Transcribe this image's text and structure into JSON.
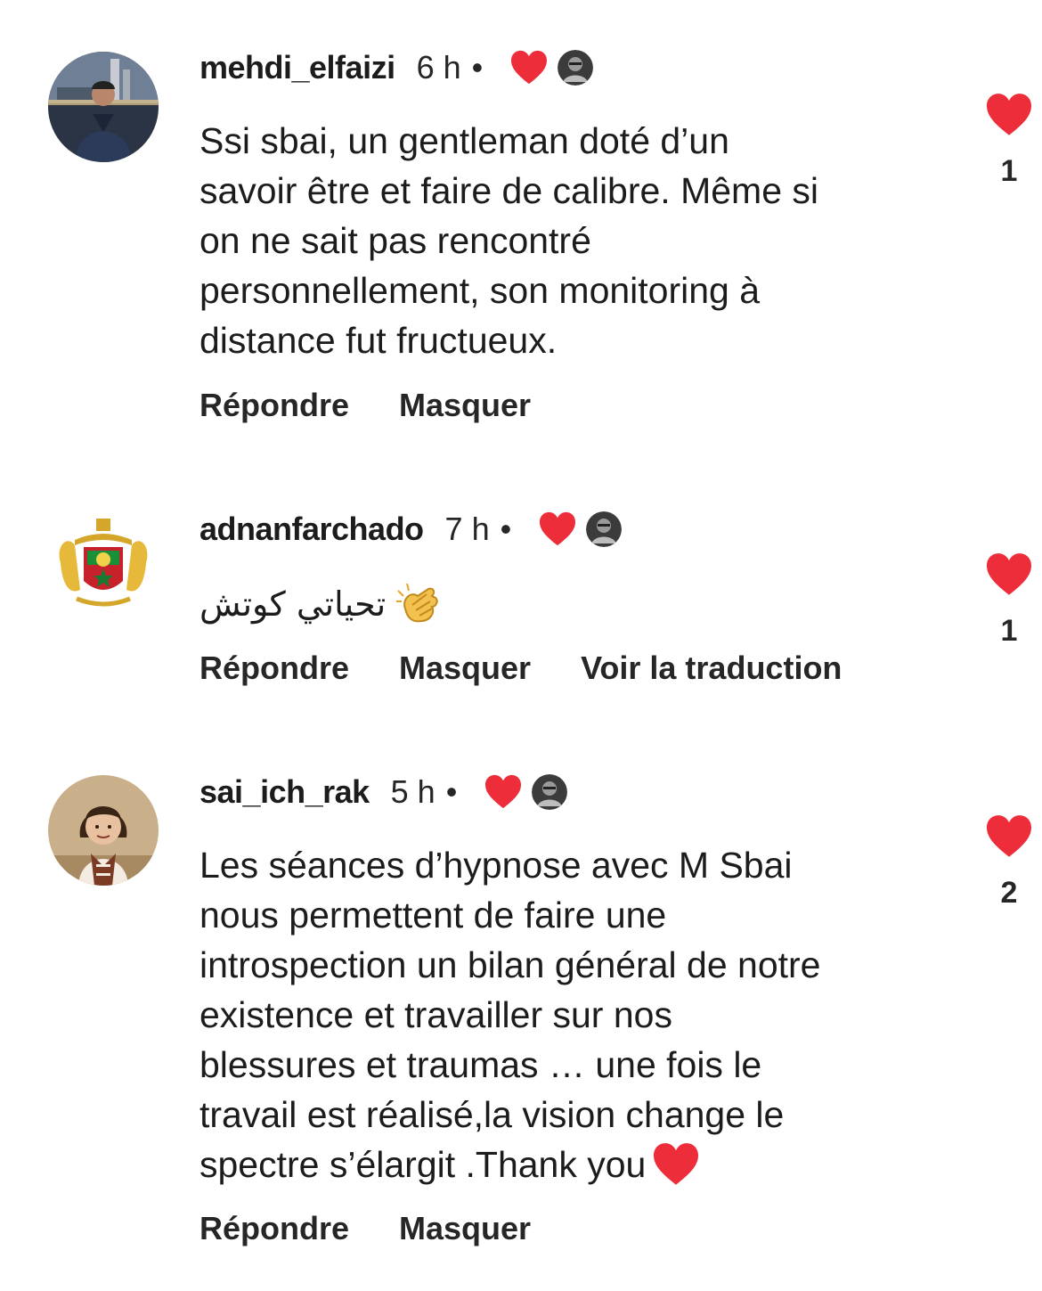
{
  "comments": [
    {
      "username": "mehdi_elfaizi",
      "time": "6 h",
      "separator": "•",
      "text_lines": [
        "Ssi sbai, un gentleman doté d’un",
        "savoir être et faire de calibre. Même si",
        "on ne sait pas rencontré",
        "personnellement, son monitoring à",
        "distance fut fructueux."
      ],
      "actions": [
        "Répondre",
        "Masquer"
      ],
      "like_count": "1"
    },
    {
      "username": "adnanfarchado",
      "time": "7 h",
      "separator": "•",
      "text": "تحياتي كوتش",
      "actions": [
        "Répondre",
        "Masquer",
        "Voir la traduction"
      ],
      "like_count": "1"
    },
    {
      "username": "sai_ich_rak",
      "time": "5 h",
      "separator": "•",
      "text_lines": [
        "Les séances d’hypnose avec M Sbai",
        "nous permettent de faire une",
        "introspection un bilan général de notre",
        "existence et travailler sur nos",
        "blessures et traumas … une fois le",
        "travail est réalisé,la vision change le",
        "spectre s’élargit .Thank you"
      ],
      "actions": [
        "Répondre",
        "Masquer"
      ],
      "like_count": "2"
    }
  ],
  "icons": {
    "heart": "heart-icon",
    "clap": "clapping-hands-icon",
    "creator": "creator-avatar-icon"
  },
  "colors": {
    "heart_red": "#ed2d3a",
    "text": "#1c1c1c"
  }
}
